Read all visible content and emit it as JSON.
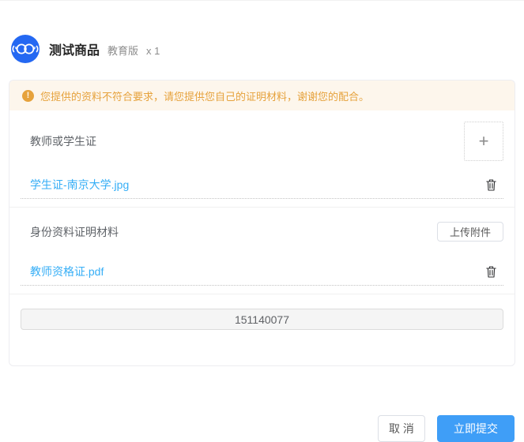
{
  "product": {
    "title": "测试商品",
    "edition": "教育版",
    "quantity": "x 1"
  },
  "alert": {
    "icon": "exclamation-circle",
    "text": "您提供的资料不符合要求，请您提供您自己的证明材料，谢谢您的配合。"
  },
  "sections": [
    {
      "label": "教师或学生证",
      "upload_plus": "+",
      "file": "学生证-南京大学.jpg"
    },
    {
      "label": "身份资料证明材料",
      "upload_button": "上传附件",
      "file": "教师资格证.pdf"
    }
  ],
  "account_field": {
    "value": "151140077"
  },
  "footer": {
    "cancel": "取 消",
    "submit": "立即提交"
  },
  "colors": {
    "logo_blue": "#2468f2",
    "link_blue": "#36aef6",
    "primary_blue": "#3f9ef7",
    "warning_text": "#e6a23c",
    "warning_bg": "#fdf6ec"
  }
}
